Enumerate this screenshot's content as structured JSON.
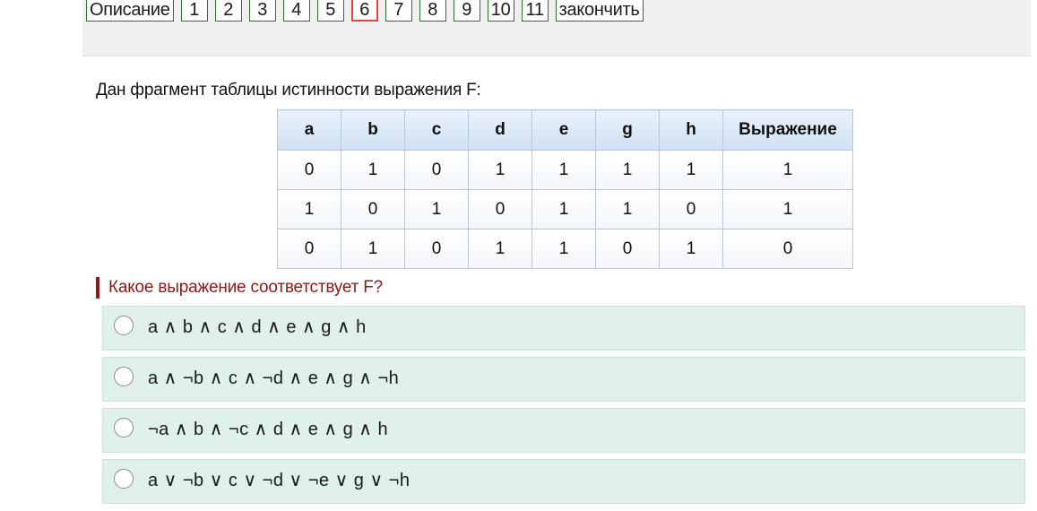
{
  "nav": {
    "description_label": "Описание",
    "numbers": [
      "1",
      "2",
      "3",
      "4",
      "5",
      "6",
      "7",
      "8",
      "9",
      "10",
      "11"
    ],
    "current": "6",
    "finish_label": "закончить"
  },
  "intro_text": "Дан фрагмент таблицы истинности выражения F:",
  "table": {
    "headers": [
      "a",
      "b",
      "c",
      "d",
      "e",
      "g",
      "h",
      "Выражение"
    ],
    "rows": [
      [
        "0",
        "1",
        "0",
        "1",
        "1",
        "1",
        "1",
        "1"
      ],
      [
        "1",
        "0",
        "1",
        "0",
        "1",
        "1",
        "0",
        "1"
      ],
      [
        "0",
        "1",
        "0",
        "1",
        "1",
        "0",
        "1",
        "0"
      ]
    ]
  },
  "question_text": "Какое выражение соответствует F?",
  "options": [
    "a ∧ b ∧ c ∧ d ∧ e ∧ g ∧ h",
    "a ∧ ¬b ∧ c ∧ ¬d ∧ e ∧ g ∧ ¬h",
    "¬a ∧ b ∧ ¬c ∧ d ∧ e ∧ g ∧ h",
    "a ∨ ¬b ∨ c ∨ ¬d ∨ ¬e ∨ g ∨ ¬h"
  ]
}
